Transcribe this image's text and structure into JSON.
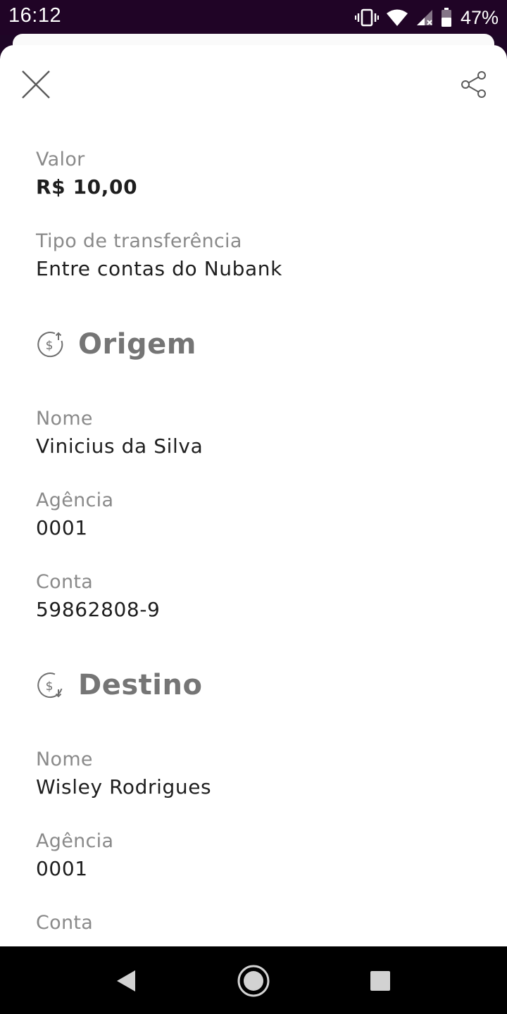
{
  "status_bar": {
    "time": "16:12",
    "battery_percent": "47%",
    "icons": [
      "vibrate-icon",
      "wifi-icon",
      "signal-icon",
      "battery-icon"
    ]
  },
  "toolbar": {
    "close_icon": "close-icon",
    "share_icon": "share-icon"
  },
  "details": {
    "valor_label": "Valor",
    "valor_value": "R$ 10,00",
    "tipo_label": "Tipo de transferência",
    "tipo_value": "Entre contas do Nubank"
  },
  "origem": {
    "title": "Origem",
    "icon": "money-out-icon",
    "nome_label": "Nome",
    "nome_value": "Vinicius da Silva",
    "agencia_label": "Agência",
    "agencia_value": "0001",
    "conta_label": "Conta",
    "conta_value": "59862808-9"
  },
  "destino": {
    "title": "Destino",
    "icon": "money-in-icon",
    "nome_label": "Nome",
    "nome_value": "Wisley Rodrigues",
    "agencia_label": "Agência",
    "agencia_value": "0001",
    "conta_label": "Conta"
  },
  "nav_bar": {
    "icons": [
      "back-icon",
      "home-icon",
      "recents-icon"
    ]
  },
  "colors": {
    "status_bar": "#200426",
    "label": "#8a8a8a",
    "value": "#1e1e1e",
    "section_title": "#757575"
  }
}
